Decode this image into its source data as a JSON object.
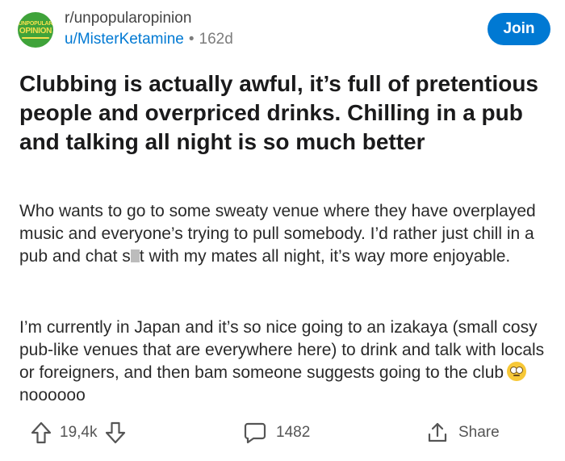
{
  "post": {
    "subreddit": "r/unpopularopinion",
    "subreddit_logo": {
      "line1": "UNPOPULAR",
      "line2": "OPINION",
      "bg_color": "#3fa33a",
      "text_color": "#f4e04d"
    },
    "author": "u/MisterKetamine",
    "separator": "•",
    "age": "162d",
    "join_label": "Join",
    "title": "Clubbing is actually awful, it’s full of pretentious people and overpriced drinks. Chilling in a pub and talking all night is so much better",
    "body": {
      "p1_before_censor": "Who wants to go to some sweaty venue where they have overplayed music and everyone’s trying to pull somebody. I’d rather just chill in a pub and chat s",
      "p1_after_censor": "t with my mates all night, it’s way more enjoyable.",
      "p2_before_emoji": "I’m currently in Japan and it’s so nice going to an izakaya (small cosy pub-like venues that are everywhere here) to drink and talk with locals or foreigners, and then bam someone suggests going to the club",
      "p2_after_emoji": "noooooo",
      "emoji": "face-with-rolling-eyes"
    },
    "actions": {
      "votes": "19,4k",
      "comments": "1482",
      "share_label": "Share"
    }
  },
  "icons": {
    "upvote": "upvote-arrow-icon",
    "downvote": "downvote-arrow-icon",
    "comment": "comment-bubble-icon",
    "share": "share-icon"
  },
  "colors": {
    "accent": "#0079d3",
    "text": "#1a1a1b",
    "muted": "#7c7c7c"
  }
}
